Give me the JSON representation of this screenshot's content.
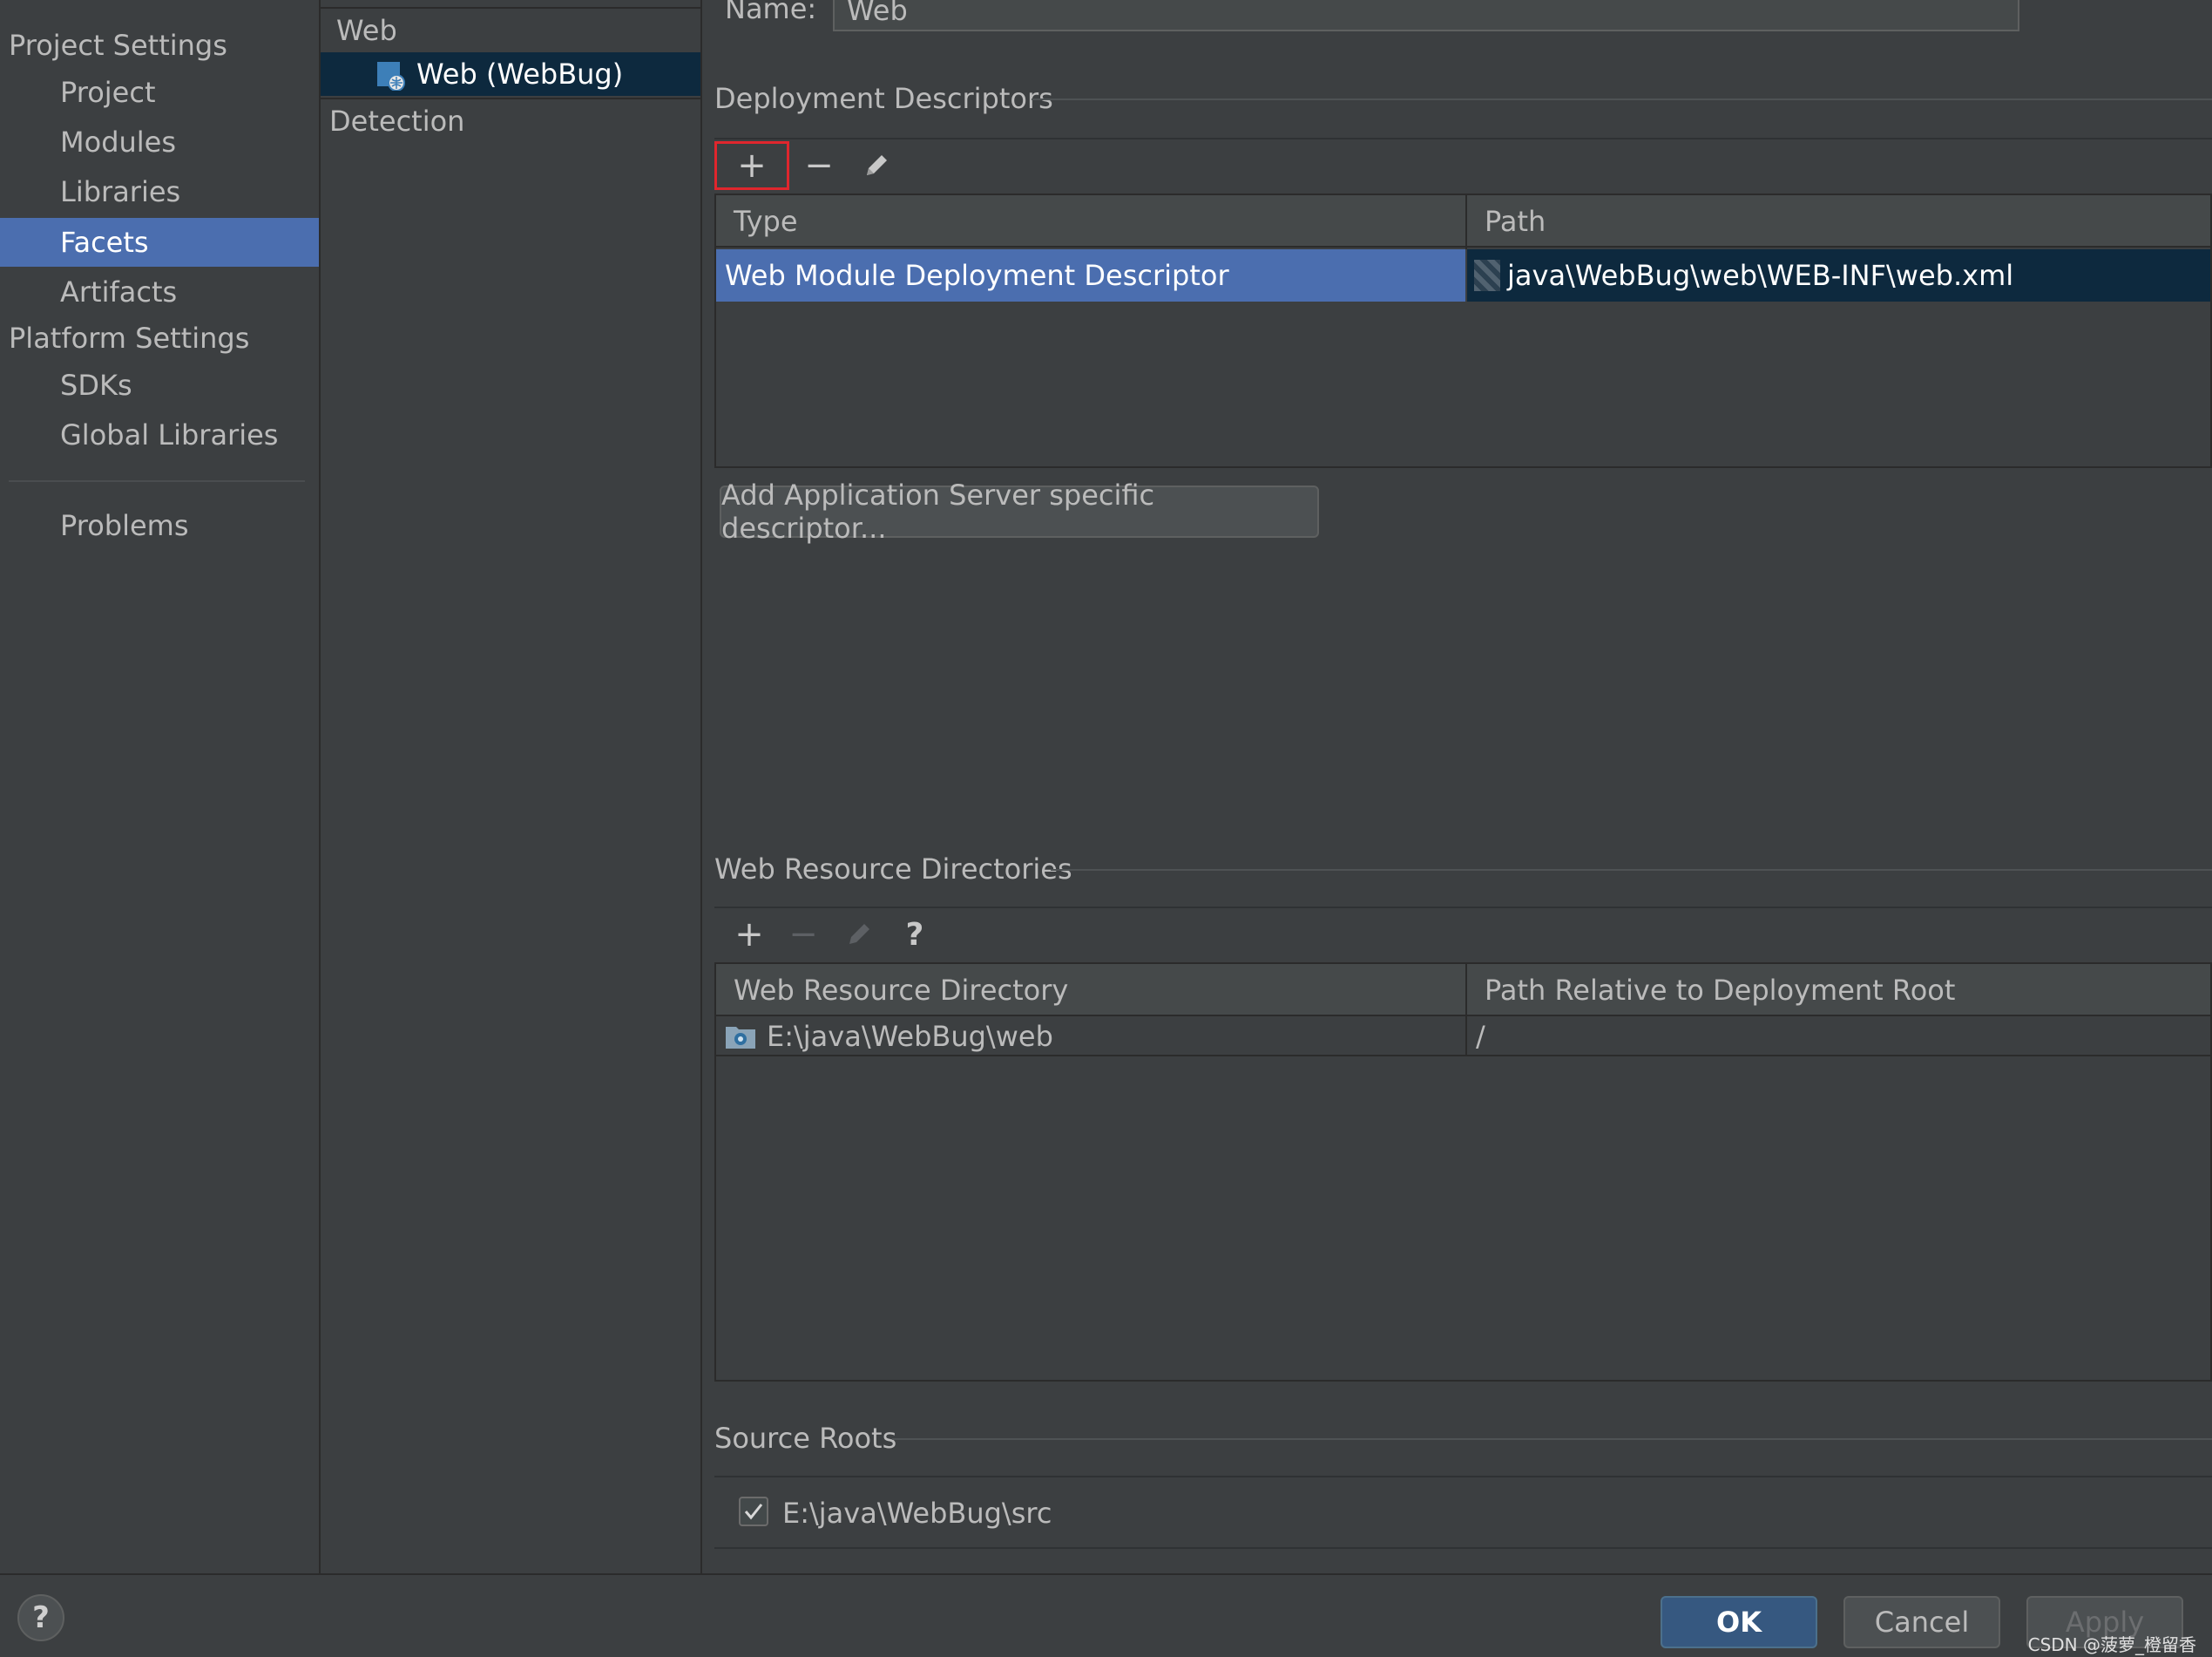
{
  "nav": {
    "project_settings_header": "Project Settings",
    "project_items": [
      "Project",
      "Modules",
      "Libraries",
      "Facets",
      "Artifacts"
    ],
    "platform_settings_header": "Platform Settings",
    "platform_items": [
      "SDKs",
      "Global Libraries"
    ],
    "problems": "Problems",
    "selected": "Facets"
  },
  "tree": {
    "group": "Web",
    "facet_item": "Web (WebBug)",
    "detection": "Detection"
  },
  "name_field": {
    "label": "Name:",
    "value": "Web"
  },
  "deployment_descriptors": {
    "title": "Deployment Descriptors",
    "toolbar": {
      "add": "+",
      "remove": "−",
      "edit_icon": "pencil-icon"
    },
    "columns": [
      "Type",
      "Path"
    ],
    "rows": [
      {
        "type": "Web Module Deployment Descriptor",
        "path": "java\\WebBug\\web\\WEB-INF\\web.xml"
      }
    ],
    "add_server_descriptor_button": "Add Application Server specific descriptor..."
  },
  "web_resource_directories": {
    "title": "Web Resource Directories",
    "toolbar": {
      "add": "+",
      "remove": "−",
      "edit_icon": "pencil-icon",
      "help": "?"
    },
    "columns": [
      "Web Resource Directory",
      "Path Relative to Deployment Root"
    ],
    "rows": [
      {
        "directory": "E:\\java\\WebBug\\web",
        "relative_path": "/"
      }
    ]
  },
  "source_roots": {
    "title": "Source Roots",
    "items": [
      {
        "path": "E:\\java\\WebBug\\src",
        "checked": true
      }
    ]
  },
  "footer": {
    "help": "?",
    "ok": "OK",
    "cancel": "Cancel",
    "apply": "Apply",
    "watermark": "CSDN @菠萝_橙留香"
  },
  "colors": {
    "background": "#3c3f41",
    "selection_blue": "#4b6eaf",
    "selection_dark": "#0d293e",
    "highlight_red": "#e0262d",
    "ok_button": "#365880"
  }
}
